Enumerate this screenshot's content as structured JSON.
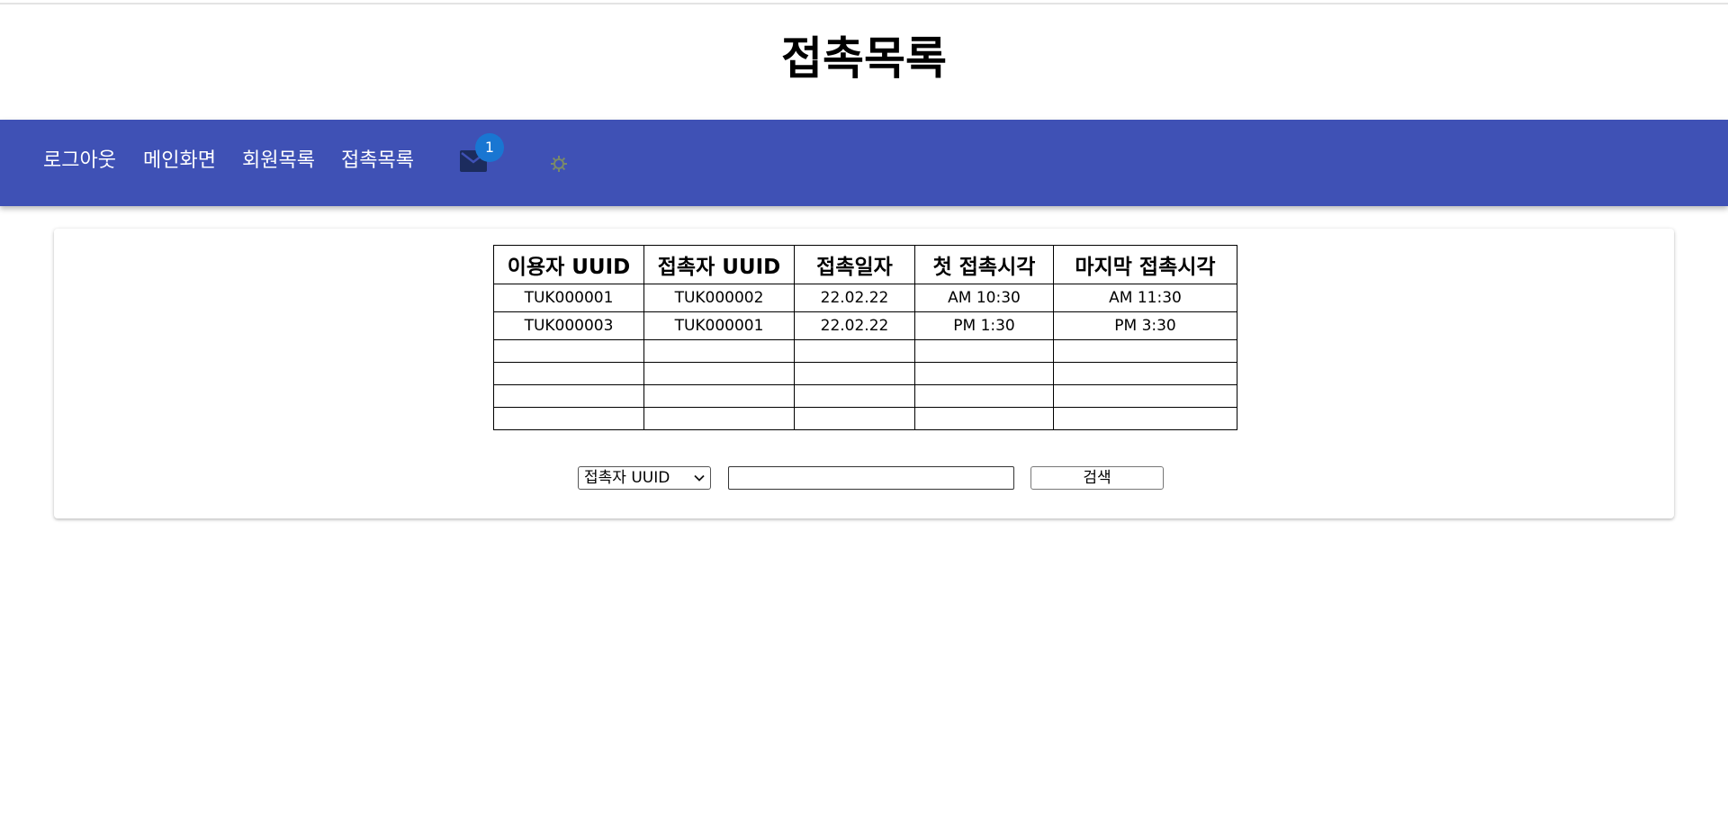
{
  "page": {
    "title": "접촉목록"
  },
  "nav": {
    "items": [
      {
        "label": "로그아웃"
      },
      {
        "label": "메인화면"
      },
      {
        "label": "회원목록"
      },
      {
        "label": "접촉목록"
      }
    ],
    "mail_badge_count": "1",
    "icons": [
      "mail-icon",
      "gear-icon"
    ]
  },
  "table": {
    "headers": [
      "이용자 UUID",
      "접촉자 UUID",
      "접촉일자",
      "첫 접촉시각",
      "마지막 접촉시각"
    ],
    "rows": [
      [
        "TUK000001",
        "TUK000002",
        "22.02.22",
        "AM 10:30",
        "AM 11:30"
      ],
      [
        "TUK000003",
        "TUK000001",
        "22.02.22",
        "PM 1:30",
        "PM 3:30"
      ]
    ],
    "empty_row_count": 4
  },
  "search": {
    "select_value": "접촉자 UUID",
    "input_value": "",
    "button_label": "검색"
  },
  "colors": {
    "navbar": "#3f51b5",
    "badge": "#1976d2",
    "mail_icon": "#1c2c5e",
    "gear_icon": "#7a8a68"
  }
}
